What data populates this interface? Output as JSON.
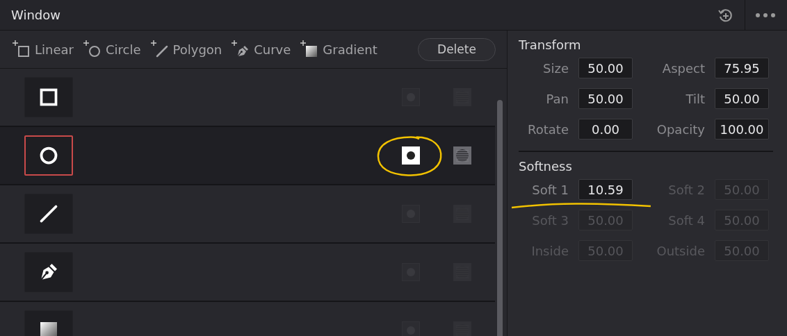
{
  "window": {
    "title": "Window"
  },
  "toolbar": {
    "tools": [
      {
        "kind": "square",
        "label": "Linear"
      },
      {
        "kind": "circle",
        "label": "Circle"
      },
      {
        "kind": "line",
        "label": "Polygon"
      },
      {
        "kind": "pen",
        "label": "Curve"
      },
      {
        "kind": "gradient",
        "label": "Gradient"
      }
    ],
    "delete": "Delete"
  },
  "windows": [
    {
      "kind": "square",
      "selected": false,
      "invert": false
    },
    {
      "kind": "circle",
      "selected": true,
      "invert": true
    },
    {
      "kind": "line",
      "selected": false,
      "invert": false
    },
    {
      "kind": "pen",
      "selected": false,
      "invert": false
    },
    {
      "kind": "gradient",
      "selected": false,
      "invert": false
    }
  ],
  "transform": {
    "title": "Transform",
    "fields": [
      {
        "label": "Size",
        "value": "50.00"
      },
      {
        "label": "Aspect",
        "value": "75.95"
      },
      {
        "label": "Pan",
        "value": "50.00"
      },
      {
        "label": "Tilt",
        "value": "50.00"
      },
      {
        "label": "Rotate",
        "value": "0.00"
      },
      {
        "label": "Opacity",
        "value": "100.00"
      }
    ]
  },
  "softness": {
    "title": "Softness",
    "fields": [
      {
        "label": "Soft 1",
        "value": "10.59",
        "disabled": false
      },
      {
        "label": "Soft 2",
        "value": "50.00",
        "disabled": true
      },
      {
        "label": "Soft 3",
        "value": "50.00",
        "disabled": true
      },
      {
        "label": "Soft 4",
        "value": "50.00",
        "disabled": true
      },
      {
        "label": "Inside",
        "value": "50.00",
        "disabled": true
      },
      {
        "label": "Outside",
        "value": "50.00",
        "disabled": true
      }
    ]
  },
  "annotations": [
    {
      "kind": "circle"
    },
    {
      "kind": "underline"
    }
  ]
}
